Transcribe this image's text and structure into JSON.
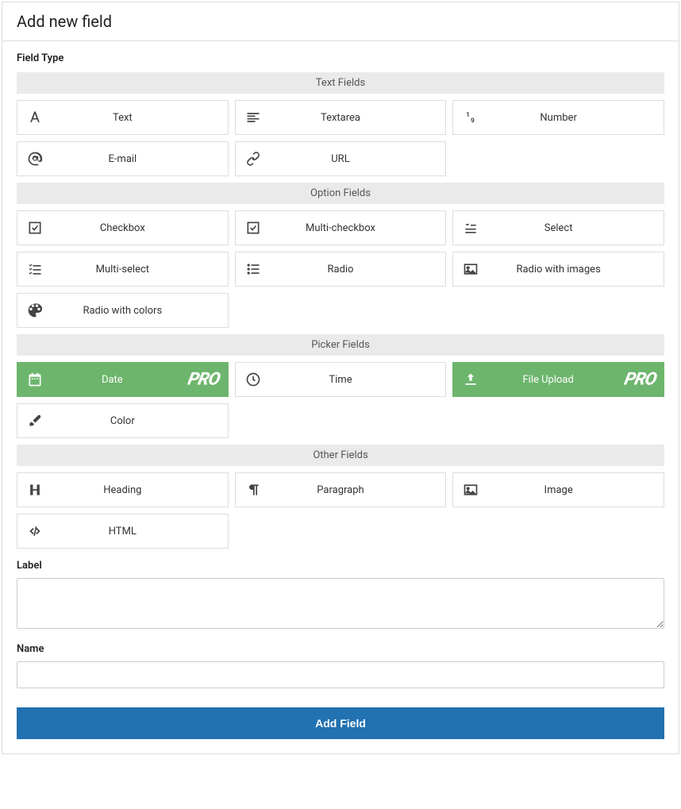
{
  "header": {
    "title": "Add new field"
  },
  "sections": {
    "field_type_label": "Field Type",
    "groups": {
      "text": {
        "header": "Text Fields",
        "items": {
          "text": "Text",
          "textarea": "Textarea",
          "number": "Number",
          "email": "E-mail",
          "url": "URL"
        }
      },
      "option": {
        "header": "Option Fields",
        "items": {
          "checkbox": "Checkbox",
          "multi_checkbox": "Multi-checkbox",
          "select": "Select",
          "multi_select": "Multi-select",
          "radio": "Radio",
          "radio_images": "Radio with images",
          "radio_colors": "Radio with colors"
        }
      },
      "picker": {
        "header": "Picker Fields",
        "items": {
          "date": "Date",
          "time": "Time",
          "file_upload": "File Upload",
          "color": "Color"
        }
      },
      "other": {
        "header": "Other Fields",
        "items": {
          "heading": "Heading",
          "paragraph": "Paragraph",
          "image": "Image",
          "html": "HTML"
        }
      }
    }
  },
  "form": {
    "label_label": "Label",
    "label_value": "",
    "name_label": "Name",
    "name_value": ""
  },
  "pro_badge": "PRO",
  "submit": {
    "label": "Add Field"
  }
}
